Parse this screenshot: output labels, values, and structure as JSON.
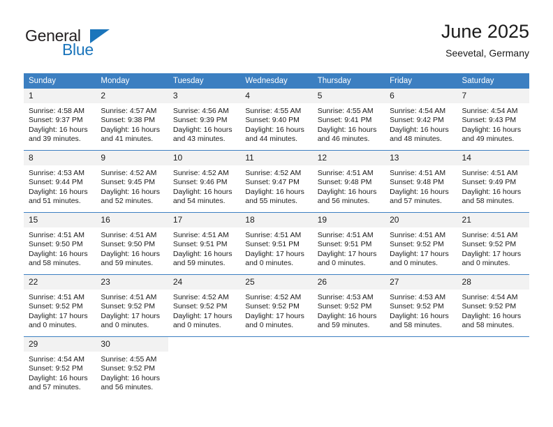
{
  "brand": {
    "name_dark": "General",
    "name_blue": "Blue",
    "accent_color": "#1b75bb",
    "header_color": "#3c7fc1"
  },
  "header": {
    "title": "June 2025",
    "subtitle": "Seevetal, Germany"
  },
  "weekday_headers": [
    "Sunday",
    "Monday",
    "Tuesday",
    "Wednesday",
    "Thursday",
    "Friday",
    "Saturday"
  ],
  "weeks": [
    [
      {
        "day": "1",
        "sunrise": "Sunrise: 4:58 AM",
        "sunset": "Sunset: 9:37 PM",
        "daylight1": "Daylight: 16 hours",
        "daylight2": "and 39 minutes."
      },
      {
        "day": "2",
        "sunrise": "Sunrise: 4:57 AM",
        "sunset": "Sunset: 9:38 PM",
        "daylight1": "Daylight: 16 hours",
        "daylight2": "and 41 minutes."
      },
      {
        "day": "3",
        "sunrise": "Sunrise: 4:56 AM",
        "sunset": "Sunset: 9:39 PM",
        "daylight1": "Daylight: 16 hours",
        "daylight2": "and 43 minutes."
      },
      {
        "day": "4",
        "sunrise": "Sunrise: 4:55 AM",
        "sunset": "Sunset: 9:40 PM",
        "daylight1": "Daylight: 16 hours",
        "daylight2": "and 44 minutes."
      },
      {
        "day": "5",
        "sunrise": "Sunrise: 4:55 AM",
        "sunset": "Sunset: 9:41 PM",
        "daylight1": "Daylight: 16 hours",
        "daylight2": "and 46 minutes."
      },
      {
        "day": "6",
        "sunrise": "Sunrise: 4:54 AM",
        "sunset": "Sunset: 9:42 PM",
        "daylight1": "Daylight: 16 hours",
        "daylight2": "and 48 minutes."
      },
      {
        "day": "7",
        "sunrise": "Sunrise: 4:54 AM",
        "sunset": "Sunset: 9:43 PM",
        "daylight1": "Daylight: 16 hours",
        "daylight2": "and 49 minutes."
      }
    ],
    [
      {
        "day": "8",
        "sunrise": "Sunrise: 4:53 AM",
        "sunset": "Sunset: 9:44 PM",
        "daylight1": "Daylight: 16 hours",
        "daylight2": "and 51 minutes."
      },
      {
        "day": "9",
        "sunrise": "Sunrise: 4:52 AM",
        "sunset": "Sunset: 9:45 PM",
        "daylight1": "Daylight: 16 hours",
        "daylight2": "and 52 minutes."
      },
      {
        "day": "10",
        "sunrise": "Sunrise: 4:52 AM",
        "sunset": "Sunset: 9:46 PM",
        "daylight1": "Daylight: 16 hours",
        "daylight2": "and 54 minutes."
      },
      {
        "day": "11",
        "sunrise": "Sunrise: 4:52 AM",
        "sunset": "Sunset: 9:47 PM",
        "daylight1": "Daylight: 16 hours",
        "daylight2": "and 55 minutes."
      },
      {
        "day": "12",
        "sunrise": "Sunrise: 4:51 AM",
        "sunset": "Sunset: 9:48 PM",
        "daylight1": "Daylight: 16 hours",
        "daylight2": "and 56 minutes."
      },
      {
        "day": "13",
        "sunrise": "Sunrise: 4:51 AM",
        "sunset": "Sunset: 9:48 PM",
        "daylight1": "Daylight: 16 hours",
        "daylight2": "and 57 minutes."
      },
      {
        "day": "14",
        "sunrise": "Sunrise: 4:51 AM",
        "sunset": "Sunset: 9:49 PM",
        "daylight1": "Daylight: 16 hours",
        "daylight2": "and 58 minutes."
      }
    ],
    [
      {
        "day": "15",
        "sunrise": "Sunrise: 4:51 AM",
        "sunset": "Sunset: 9:50 PM",
        "daylight1": "Daylight: 16 hours",
        "daylight2": "and 58 minutes."
      },
      {
        "day": "16",
        "sunrise": "Sunrise: 4:51 AM",
        "sunset": "Sunset: 9:50 PM",
        "daylight1": "Daylight: 16 hours",
        "daylight2": "and 59 minutes."
      },
      {
        "day": "17",
        "sunrise": "Sunrise: 4:51 AM",
        "sunset": "Sunset: 9:51 PM",
        "daylight1": "Daylight: 16 hours",
        "daylight2": "and 59 minutes."
      },
      {
        "day": "18",
        "sunrise": "Sunrise: 4:51 AM",
        "sunset": "Sunset: 9:51 PM",
        "daylight1": "Daylight: 17 hours",
        "daylight2": "and 0 minutes."
      },
      {
        "day": "19",
        "sunrise": "Sunrise: 4:51 AM",
        "sunset": "Sunset: 9:51 PM",
        "daylight1": "Daylight: 17 hours",
        "daylight2": "and 0 minutes."
      },
      {
        "day": "20",
        "sunrise": "Sunrise: 4:51 AM",
        "sunset": "Sunset: 9:52 PM",
        "daylight1": "Daylight: 17 hours",
        "daylight2": "and 0 minutes."
      },
      {
        "day": "21",
        "sunrise": "Sunrise: 4:51 AM",
        "sunset": "Sunset: 9:52 PM",
        "daylight1": "Daylight: 17 hours",
        "daylight2": "and 0 minutes."
      }
    ],
    [
      {
        "day": "22",
        "sunrise": "Sunrise: 4:51 AM",
        "sunset": "Sunset: 9:52 PM",
        "daylight1": "Daylight: 17 hours",
        "daylight2": "and 0 minutes."
      },
      {
        "day": "23",
        "sunrise": "Sunrise: 4:51 AM",
        "sunset": "Sunset: 9:52 PM",
        "daylight1": "Daylight: 17 hours",
        "daylight2": "and 0 minutes."
      },
      {
        "day": "24",
        "sunrise": "Sunrise: 4:52 AM",
        "sunset": "Sunset: 9:52 PM",
        "daylight1": "Daylight: 17 hours",
        "daylight2": "and 0 minutes."
      },
      {
        "day": "25",
        "sunrise": "Sunrise: 4:52 AM",
        "sunset": "Sunset: 9:52 PM",
        "daylight1": "Daylight: 17 hours",
        "daylight2": "and 0 minutes."
      },
      {
        "day": "26",
        "sunrise": "Sunrise: 4:53 AM",
        "sunset": "Sunset: 9:52 PM",
        "daylight1": "Daylight: 16 hours",
        "daylight2": "and 59 minutes."
      },
      {
        "day": "27",
        "sunrise": "Sunrise: 4:53 AM",
        "sunset": "Sunset: 9:52 PM",
        "daylight1": "Daylight: 16 hours",
        "daylight2": "and 58 minutes."
      },
      {
        "day": "28",
        "sunrise": "Sunrise: 4:54 AM",
        "sunset": "Sunset: 9:52 PM",
        "daylight1": "Daylight: 16 hours",
        "daylight2": "and 58 minutes."
      }
    ],
    [
      {
        "day": "29",
        "sunrise": "Sunrise: 4:54 AM",
        "sunset": "Sunset: 9:52 PM",
        "daylight1": "Daylight: 16 hours",
        "daylight2": "and 57 minutes."
      },
      {
        "day": "30",
        "sunrise": "Sunrise: 4:55 AM",
        "sunset": "Sunset: 9:52 PM",
        "daylight1": "Daylight: 16 hours",
        "daylight2": "and 56 minutes."
      },
      {
        "day": "",
        "sunrise": "",
        "sunset": "",
        "daylight1": "",
        "daylight2": ""
      },
      {
        "day": "",
        "sunrise": "",
        "sunset": "",
        "daylight1": "",
        "daylight2": ""
      },
      {
        "day": "",
        "sunrise": "",
        "sunset": "",
        "daylight1": "",
        "daylight2": ""
      },
      {
        "day": "",
        "sunrise": "",
        "sunset": "",
        "daylight1": "",
        "daylight2": ""
      },
      {
        "day": "",
        "sunrise": "",
        "sunset": "",
        "daylight1": "",
        "daylight2": ""
      }
    ]
  ]
}
